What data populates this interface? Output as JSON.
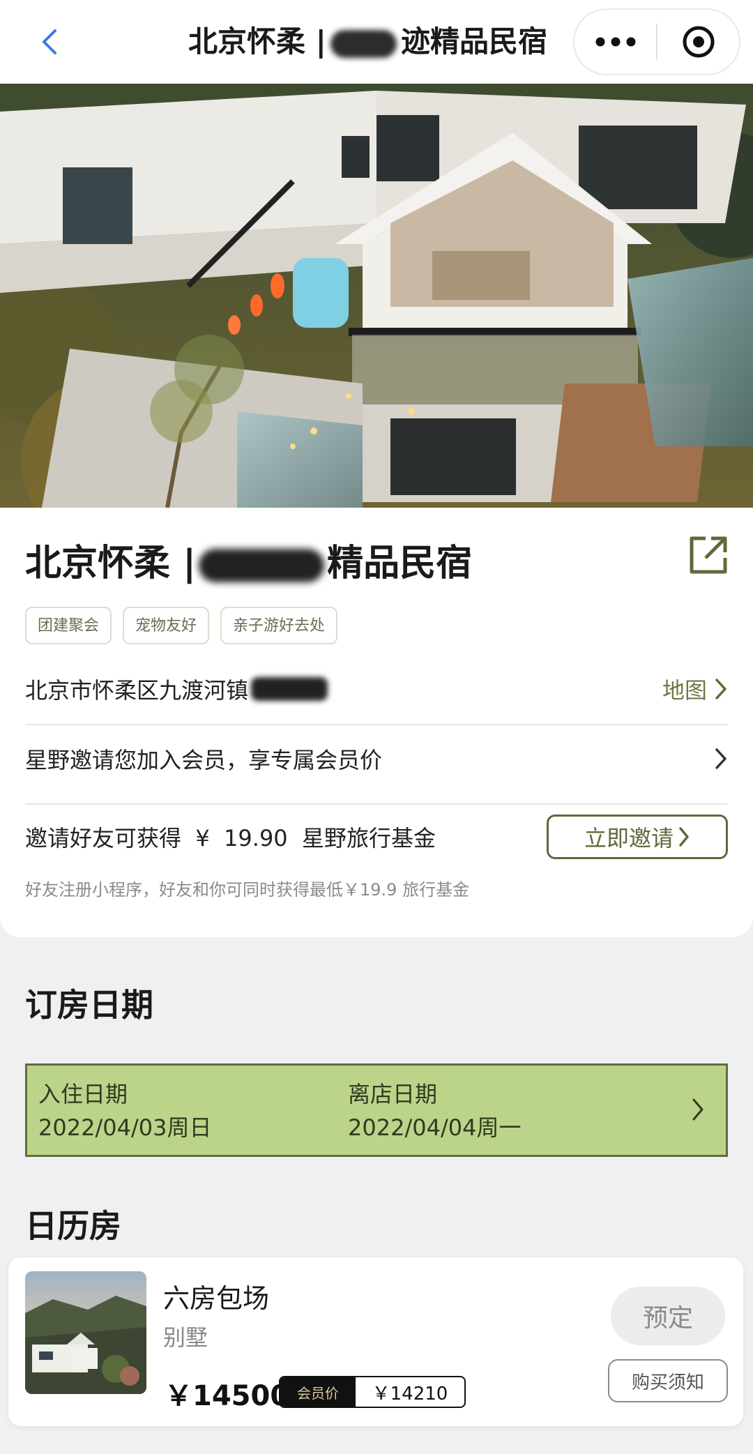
{
  "colors": {
    "accent": "#5d6a3a",
    "date_box": "#bcd48a",
    "nav_back": "#3b7be0"
  },
  "navbar": {
    "back_icon": "chevron-left-icon",
    "title_prefix": "北京怀柔 |",
    "title_suffix": "迹精品民宿",
    "more_icon": "more-dots-icon",
    "close_icon": "target-circle-icon"
  },
  "property": {
    "title_prefix": "北京怀柔 |",
    "title_suffix": "精品民宿",
    "share_icon": "share-external-icon",
    "tags": [
      "团建聚会",
      "宠物友好",
      "亲子游好去处"
    ],
    "address": "北京市怀柔区九渡河镇",
    "map_label": "地图",
    "member_invite": "星野邀请您加入会员，享专属会员价",
    "invite_text": "邀请好友可获得  ¥  19.90  星野旅行基金",
    "invite_button": "立即邀请",
    "invite_note": "好友注册小程序，好友和你可同时获得最低￥19.9 旅行基金"
  },
  "booking": {
    "section_title": "订房日期",
    "checkin_label": "入住日期",
    "checkin_value": "2022/04/03周日",
    "checkout_label": "离店日期",
    "checkout_value": "2022/04/04周一"
  },
  "calendar_rooms": {
    "section_title": "日历房",
    "room": {
      "name": "六房包场",
      "type": "别墅",
      "price": "￥14500",
      "member_label": "会员价",
      "member_price": "￥14210",
      "book_button": "预定",
      "notice_button": "购买须知"
    }
  }
}
